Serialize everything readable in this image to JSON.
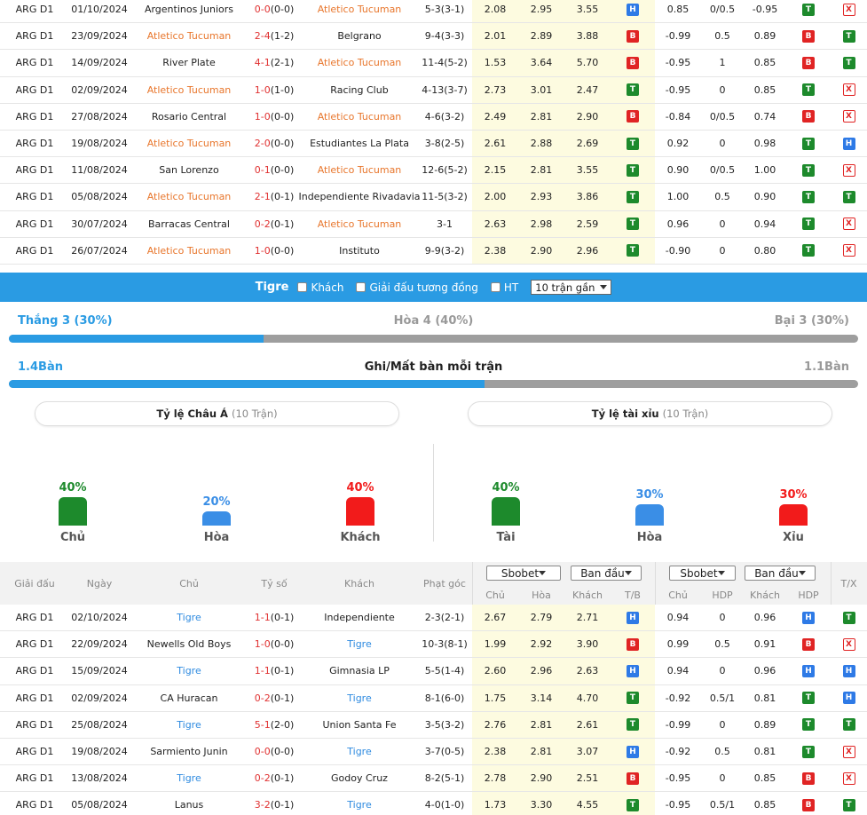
{
  "top_matches": [
    {
      "league": "ARG D1",
      "date": "01/10/2024",
      "home": "Argentinos Juniors",
      "home_hl": false,
      "score": "0-0",
      "ht": "(0-0)",
      "away": "Atletico Tucuman",
      "away_hl": true,
      "corner": "5-3(3-1)",
      "o1": "2.08",
      "o2": "2.95",
      "o3": "3.55",
      "tb": "H",
      "h1": "0.85",
      "h2": "0/0.5",
      "h3": "-0.95",
      "hdp": "T",
      "tx": "X"
    },
    {
      "league": "ARG D1",
      "date": "23/09/2024",
      "home": "Atletico Tucuman",
      "home_hl": true,
      "score": "2-4",
      "ht": "(1-2)",
      "away": "Belgrano",
      "away_hl": false,
      "corner": "9-4(3-3)",
      "o1": "2.01",
      "o2": "2.89",
      "o3": "3.88",
      "tb": "B",
      "h1": "-0.99",
      "h2": "0.5",
      "h3": "0.89",
      "hdp": "B",
      "tx": "T"
    },
    {
      "league": "ARG D1",
      "date": "14/09/2024",
      "home": "River Plate",
      "home_hl": false,
      "score": "4-1",
      "ht": "(2-1)",
      "away": "Atletico Tucuman",
      "away_hl": true,
      "corner": "11-4(5-2)",
      "o1": "1.53",
      "o2": "3.64",
      "o3": "5.70",
      "tb": "B",
      "h1": "-0.95",
      "h2": "1",
      "h3": "0.85",
      "hdp": "B",
      "tx": "T"
    },
    {
      "league": "ARG D1",
      "date": "02/09/2024",
      "home": "Atletico Tucuman",
      "home_hl": true,
      "score": "1-0",
      "ht": "(1-0)",
      "away": "Racing Club",
      "away_hl": false,
      "corner": "4-13(3-7)",
      "o1": "2.73",
      "o2": "3.01",
      "o3": "2.47",
      "tb": "T",
      "h1": "-0.95",
      "h2": "0",
      "h3": "0.85",
      "hdp": "T",
      "tx": "X"
    },
    {
      "league": "ARG D1",
      "date": "27/08/2024",
      "home": "Rosario Central",
      "home_hl": false,
      "score": "1-0",
      "ht": "(0-0)",
      "away": "Atletico Tucuman",
      "away_hl": true,
      "corner": "4-6(3-2)",
      "o1": "2.49",
      "o2": "2.81",
      "o3": "2.90",
      "tb": "B",
      "h1": "-0.84",
      "h2": "0/0.5",
      "h3": "0.74",
      "hdp": "B",
      "tx": "X"
    },
    {
      "league": "ARG D1",
      "date": "19/08/2024",
      "home": "Atletico Tucuman",
      "home_hl": true,
      "score": "2-0",
      "ht": "(0-0)",
      "away": "Estudiantes La Plata",
      "away_hl": false,
      "corner": "3-8(2-5)",
      "o1": "2.61",
      "o2": "2.88",
      "o3": "2.69",
      "tb": "T",
      "h1": "0.92",
      "h2": "0",
      "h3": "0.98",
      "hdp": "T",
      "tx": "H"
    },
    {
      "league": "ARG D1",
      "date": "11/08/2024",
      "home": "San Lorenzo",
      "home_hl": false,
      "score": "0-1",
      "ht": "(0-0)",
      "away": "Atletico Tucuman",
      "away_hl": true,
      "corner": "12-6(5-2)",
      "o1": "2.15",
      "o2": "2.81",
      "o3": "3.55",
      "tb": "T",
      "h1": "0.90",
      "h2": "0/0.5",
      "h3": "1.00",
      "hdp": "T",
      "tx": "X"
    },
    {
      "league": "ARG D1",
      "date": "05/08/2024",
      "home": "Atletico Tucuman",
      "home_hl": true,
      "score": "2-1",
      "ht": "(0-1)",
      "away": "Independiente Rivadavia",
      "away_hl": false,
      "corner": "11-5(3-2)",
      "o1": "2.00",
      "o2": "2.93",
      "o3": "3.86",
      "tb": "T",
      "h1": "1.00",
      "h2": "0.5",
      "h3": "0.90",
      "hdp": "T",
      "tx": "T"
    },
    {
      "league": "ARG D1",
      "date": "30/07/2024",
      "home": "Barracas Central",
      "home_hl": false,
      "score": "0-2",
      "ht": "(0-1)",
      "away": "Atletico Tucuman",
      "away_hl": true,
      "corner": "3-1",
      "o1": "2.63",
      "o2": "2.98",
      "o3": "2.59",
      "tb": "T",
      "h1": "0.96",
      "h2": "0",
      "h3": "0.94",
      "hdp": "T",
      "tx": "X"
    },
    {
      "league": "ARG D1",
      "date": "26/07/2024",
      "home": "Atletico Tucuman",
      "home_hl": true,
      "score": "1-0",
      "ht": "(0-0)",
      "away": "Instituto",
      "away_hl": false,
      "corner": "9-9(3-2)",
      "o1": "2.38",
      "o2": "2.90",
      "o3": "2.96",
      "tb": "T",
      "h1": "-0.90",
      "h2": "0",
      "h3": "0.80",
      "hdp": "T",
      "tx": "X"
    }
  ],
  "filter": {
    "team": "Tigre",
    "away_label": "Khách",
    "same_league_label": "Giải đấu tương đồng",
    "ht_label": "HT",
    "recent_select": "10 trận gần"
  },
  "summary": {
    "win": "Thắng 3 (30%)",
    "draw": "Hòa 4 (40%)",
    "loss": "Bại 3 (30%)",
    "win_ratio": 0.3,
    "goals_for": "1.4Bàn",
    "goals_title": "Ghi/Mất bàn mỗi trận",
    "goals_against": "1.1Bàn",
    "goals_ratio": 0.56
  },
  "asian": {
    "title": "Tỷ lệ Châu Á",
    "sub": "(10 Trận)",
    "bars": [
      {
        "pct": "40%",
        "label": "Chủ",
        "value": 40,
        "color": "#1d8a2c"
      },
      {
        "pct": "20%",
        "label": "Hòa",
        "value": 20,
        "color": "#3a8ee6"
      },
      {
        "pct": "40%",
        "label": "Khách",
        "value": 40,
        "color": "#f21b1b"
      }
    ]
  },
  "ou": {
    "title": "Tỷ lệ tài xỉu",
    "sub": "(10 Trận)",
    "bars": [
      {
        "pct": "40%",
        "label": "Tài",
        "value": 40,
        "color": "#1d8a2c"
      },
      {
        "pct": "30%",
        "label": "Hòa",
        "value": 30,
        "color": "#3a8ee6"
      },
      {
        "pct": "30%",
        "label": "Xỉu",
        "value": 30,
        "color": "#f21b1b"
      }
    ]
  },
  "header": {
    "league": "Giải đấu",
    "date": "Ngày",
    "home": "Chủ",
    "score": "Tỷ số",
    "away": "Khách",
    "corner": "Phạt góc",
    "book1": "Sbobet",
    "type1": "Ban đầu",
    "book2": "Sbobet",
    "type2": "Ban đầu",
    "o1": "Chủ",
    "o2": "Hòa",
    "o3": "Khách",
    "tb": "T/B",
    "h1": "Chủ",
    "h2": "HDP",
    "h3": "Khách",
    "hdp": "HDP",
    "tx": "T/X"
  },
  "bottom_matches": [
    {
      "league": "ARG D1",
      "date": "02/10/2024",
      "home": "Tigre",
      "home_hl": true,
      "score": "1-1",
      "ht": "(0-1)",
      "away": "Independiente",
      "away_hl": false,
      "corner": "2-3(2-1)",
      "o1": "2.67",
      "o2": "2.79",
      "o3": "2.71",
      "tb": "H",
      "h1": "0.94",
      "h2": "0",
      "h3": "0.96",
      "hdp": "H",
      "tx": "T"
    },
    {
      "league": "ARG D1",
      "date": "22/09/2024",
      "home": "Newells Old Boys",
      "home_hl": false,
      "score": "1-0",
      "ht": "(0-0)",
      "away": "Tigre",
      "away_hl": true,
      "corner": "10-3(8-1)",
      "o1": "1.99",
      "o2": "2.92",
      "o3": "3.90",
      "tb": "B",
      "h1": "0.99",
      "h2": "0.5",
      "h3": "0.91",
      "hdp": "B",
      "tx": "X"
    },
    {
      "league": "ARG D1",
      "date": "15/09/2024",
      "home": "Tigre",
      "home_hl": true,
      "score": "1-1",
      "ht": "(0-1)",
      "away": "Gimnasia LP",
      "away_hl": false,
      "corner": "5-5(1-4)",
      "o1": "2.60",
      "o2": "2.96",
      "o3": "2.63",
      "tb": "H",
      "h1": "0.94",
      "h2": "0",
      "h3": "0.96",
      "hdp": "H",
      "tx": "H"
    },
    {
      "league": "ARG D1",
      "date": "02/09/2024",
      "home": "CA Huracan",
      "home_hl": false,
      "score": "0-2",
      "ht": "(0-1)",
      "away": "Tigre",
      "away_hl": true,
      "corner": "8-1(6-0)",
      "o1": "1.75",
      "o2": "3.14",
      "o3": "4.70",
      "tb": "T",
      "h1": "-0.92",
      "h2": "0.5/1",
      "h3": "0.81",
      "hdp": "T",
      "tx": "H"
    },
    {
      "league": "ARG D1",
      "date": "25/08/2024",
      "home": "Tigre",
      "home_hl": true,
      "score": "5-1",
      "ht": "(2-0)",
      "away": "Union Santa Fe",
      "away_hl": false,
      "corner": "3-5(3-2)",
      "o1": "2.76",
      "o2": "2.81",
      "o3": "2.61",
      "tb": "T",
      "h1": "-0.99",
      "h2": "0",
      "h3": "0.89",
      "hdp": "T",
      "tx": "T"
    },
    {
      "league": "ARG D1",
      "date": "19/08/2024",
      "home": "Sarmiento Junin",
      "home_hl": false,
      "score": "0-0",
      "ht": "(0-0)",
      "away": "Tigre",
      "away_hl": true,
      "corner": "3-7(0-5)",
      "o1": "2.38",
      "o2": "2.81",
      "o3": "3.07",
      "tb": "H",
      "h1": "-0.92",
      "h2": "0.5",
      "h3": "0.81",
      "hdp": "T",
      "tx": "X"
    },
    {
      "league": "ARG D1",
      "date": "13/08/2024",
      "home": "Tigre",
      "home_hl": true,
      "score": "0-2",
      "ht": "(0-1)",
      "away": "Godoy Cruz",
      "away_hl": false,
      "corner": "8-2(5-1)",
      "o1": "2.78",
      "o2": "2.90",
      "o3": "2.51",
      "tb": "B",
      "h1": "-0.95",
      "h2": "0",
      "h3": "0.85",
      "hdp": "B",
      "tx": "X"
    },
    {
      "league": "ARG D1",
      "date": "05/08/2024",
      "home": "Lanus",
      "home_hl": false,
      "score": "3-2",
      "ht": "(0-1)",
      "away": "Tigre",
      "away_hl": true,
      "corner": "4-0(1-0)",
      "o1": "1.73",
      "o2": "3.30",
      "o3": "4.55",
      "tb": "T",
      "h1": "-0.95",
      "h2": "0.5/1",
      "h3": "0.85",
      "hdp": "B",
      "tx": "T"
    }
  ]
}
